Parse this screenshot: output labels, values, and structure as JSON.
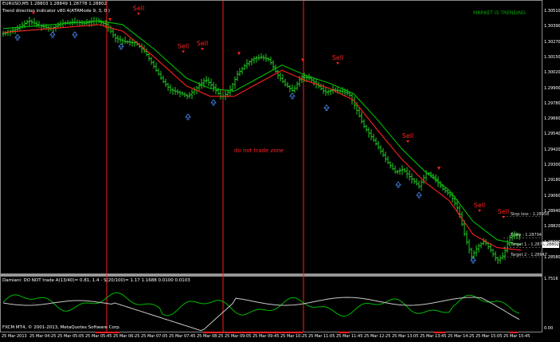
{
  "header": {
    "symbol_line": "EURUSD,M5  1.28803 1.28849 1.28778 1.28802",
    "indicator_line": "Trend direction indicator v80.4(ATRMode 9, 3, 0 )"
  },
  "trend_status": "MARKET IS TRENDING",
  "zone_label": "do not trade zone",
  "signal_text": "Sell",
  "price_axis": {
    "labels": [
      "1.30510",
      "1.30390",
      "1.30270",
      "1.30150",
      "1.30020",
      "1.29900",
      "1.29780",
      "1.29660",
      "1.29540",
      "1.29420",
      "1.29300",
      "1.29180",
      "1.29060",
      "1.28940",
      "1.28820",
      "1.28700",
      "1.28580"
    ],
    "current_price": "1.28802"
  },
  "level_lines": [
    {
      "label": "Stop loss - 1.28958",
      "price": 1.28958
    },
    {
      "label": "Entry - 1.28794",
      "price": 1.28794
    },
    {
      "label": "Target 1 - 1.28721",
      "price": 1.28721
    },
    {
      "label": "Target 2 - 1.28647",
      "price": 1.28647
    }
  ],
  "subwindow": {
    "title": "Damiani: DO NOT trade A(13/40)= 0.81, 1.4 - S(20/100)= 1.17  1.1688 0.0100 0.0103",
    "axis_top": "1.7516",
    "axis_bottom": "0.00"
  },
  "footer_left": "FXCM MT4, © 2001-2013, MetaQuotes Software Corp.",
  "time_axis": [
    "25 Mar 2013",
    "25 Mar 04:25",
    "25 Mar 05:05",
    "25 Mar 05:45",
    "25 Mar 06:25",
    "25 Mar 07:05",
    "25 Mar 07:45",
    "25 Mar 08:25",
    "25 Mar 09:05",
    "25 Mar 09:45",
    "25 Mar 10:25",
    "25 Mar 11:05",
    "25 Mar 11:45",
    "25 Mar 12:25",
    "25 Mar 13:05",
    "25 Mar 13:45",
    "25 Mar 14:25",
    "25 Mar 15:05",
    "25 Mar 15:45"
  ],
  "colors": {
    "bars": "#22cc22",
    "ma_red": "#ff2020",
    "ma_green": "#00c000",
    "vlines": "#ff1a1a",
    "status": "#00aa00",
    "sell": "#ff2020",
    "up_arrow": "#4a90ff",
    "osc_green": "#00b800",
    "osc_white": "#c8c8c8"
  },
  "chart_data": {
    "type": "candlestick",
    "symbol": "EURUSD",
    "timeframe": "M5",
    "ohlc_last": {
      "open": 1.28803,
      "high": 1.28849,
      "low": 1.28778,
      "close": 1.28802
    },
    "ylim": [
      1.2854,
      1.3057
    ],
    "close_path": [
      [
        0,
        1.3036
      ],
      [
        18,
        1.304
      ],
      [
        32,
        1.3046
      ],
      [
        46,
        1.3042
      ],
      [
        60,
        1.304
      ],
      [
        74,
        1.3044
      ],
      [
        88,
        1.3045
      ],
      [
        102,
        1.3044
      ],
      [
        116,
        1.3046
      ],
      [
        130,
        1.3043
      ],
      [
        140,
        1.3033
      ],
      [
        152,
        1.303
      ],
      [
        166,
        1.3029
      ],
      [
        178,
        1.3022
      ],
      [
        190,
        1.301
      ],
      [
        200,
        1.3
      ],
      [
        210,
        1.2993
      ],
      [
        220,
        1.2991
      ],
      [
        232,
        1.2988
      ],
      [
        242,
        1.2994
      ],
      [
        254,
        1.3001
      ],
      [
        264,
        1.2995
      ],
      [
        274,
        1.2987
      ],
      [
        284,
        1.2992
      ],
      [
        294,
        1.3005
      ],
      [
        304,
        1.3012
      ],
      [
        314,
        1.3017
      ],
      [
        324,
        1.3018
      ],
      [
        334,
        1.3016
      ],
      [
        344,
        1.3005
      ],
      [
        354,
        1.2997
      ],
      [
        364,
        1.2992
      ],
      [
        374,
        1.3003
      ],
      [
        384,
        1.3002
      ],
      [
        394,
        1.2997
      ],
      [
        404,
        1.2991
      ],
      [
        414,
        1.2993
      ],
      [
        424,
        1.2992
      ],
      [
        434,
        1.299
      ],
      [
        442,
        1.298
      ],
      [
        452,
        1.2966
      ],
      [
        462,
        1.2957
      ],
      [
        472,
        1.2948
      ],
      [
        482,
        1.2938
      ],
      [
        492,
        1.293
      ],
      [
        502,
        1.2932
      ],
      [
        512,
        1.2925
      ],
      [
        522,
        1.2919
      ],
      [
        532,
        1.293
      ],
      [
        542,
        1.2925
      ],
      [
        552,
        1.2917
      ],
      [
        562,
        1.2912
      ],
      [
        572,
        1.29
      ],
      [
        580,
        1.288
      ],
      [
        588,
        1.2865
      ],
      [
        596,
        1.2873
      ],
      [
        604,
        1.2877
      ],
      [
        612,
        1.287
      ],
      [
        620,
        1.2862
      ],
      [
        628,
        1.2866
      ],
      [
        636,
        1.288
      ],
      [
        644,
        1.2882
      ],
      [
        652,
        1.288
      ]
    ],
    "ma_red_path": [
      [
        0,
        1.3037
      ],
      [
        60,
        1.304
      ],
      [
        120,
        1.3043
      ],
      [
        150,
        1.3038
      ],
      [
        190,
        1.3018
      ],
      [
        230,
        1.2996
      ],
      [
        260,
        1.2988
      ],
      [
        290,
        1.2988
      ],
      [
        320,
        1.2998
      ],
      [
        350,
        1.3008
      ],
      [
        380,
        1.3
      ],
      [
        410,
        1.2994
      ],
      [
        440,
        1.2985
      ],
      [
        470,
        1.2962
      ],
      [
        500,
        1.294
      ],
      [
        530,
        1.2922
      ],
      [
        560,
        1.2908
      ],
      [
        590,
        1.2882
      ],
      [
        620,
        1.2872
      ],
      [
        650,
        1.287
      ]
    ],
    "ma_green_path": [
      [
        0,
        1.304
      ],
      [
        60,
        1.3043
      ],
      [
        120,
        1.3046
      ],
      [
        150,
        1.3043
      ],
      [
        190,
        1.3024
      ],
      [
        230,
        1.3002
      ],
      [
        260,
        1.2994
      ],
      [
        290,
        1.2992
      ],
      [
        320,
        1.3002
      ],
      [
        350,
        1.3012
      ],
      [
        380,
        1.3004
      ],
      [
        410,
        1.2998
      ],
      [
        440,
        1.299
      ],
      [
        470,
        1.297
      ],
      [
        500,
        1.2948
      ],
      [
        530,
        1.293
      ],
      [
        560,
        1.2916
      ],
      [
        590,
        1.2892
      ],
      [
        620,
        1.2878
      ],
      [
        650,
        1.2874
      ]
    ]
  }
}
